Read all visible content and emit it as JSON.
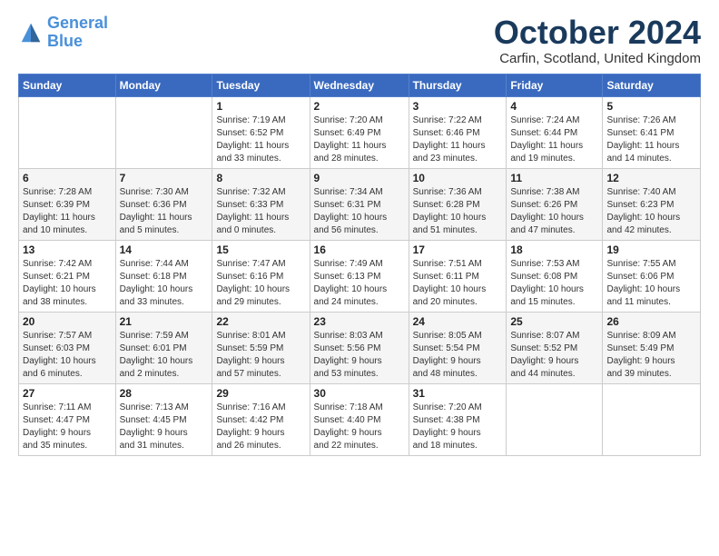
{
  "logo": {
    "line1": "General",
    "line2": "Blue"
  },
  "title": "October 2024",
  "subtitle": "Carfin, Scotland, United Kingdom",
  "days_of_week": [
    "Sunday",
    "Monday",
    "Tuesday",
    "Wednesday",
    "Thursday",
    "Friday",
    "Saturday"
  ],
  "weeks": [
    [
      {
        "day": "",
        "info": ""
      },
      {
        "day": "",
        "info": ""
      },
      {
        "day": "1",
        "info": "Sunrise: 7:19 AM\nSunset: 6:52 PM\nDaylight: 11 hours\nand 33 minutes."
      },
      {
        "day": "2",
        "info": "Sunrise: 7:20 AM\nSunset: 6:49 PM\nDaylight: 11 hours\nand 28 minutes."
      },
      {
        "day": "3",
        "info": "Sunrise: 7:22 AM\nSunset: 6:46 PM\nDaylight: 11 hours\nand 23 minutes."
      },
      {
        "day": "4",
        "info": "Sunrise: 7:24 AM\nSunset: 6:44 PM\nDaylight: 11 hours\nand 19 minutes."
      },
      {
        "day": "5",
        "info": "Sunrise: 7:26 AM\nSunset: 6:41 PM\nDaylight: 11 hours\nand 14 minutes."
      }
    ],
    [
      {
        "day": "6",
        "info": "Sunrise: 7:28 AM\nSunset: 6:39 PM\nDaylight: 11 hours\nand 10 minutes."
      },
      {
        "day": "7",
        "info": "Sunrise: 7:30 AM\nSunset: 6:36 PM\nDaylight: 11 hours\nand 5 minutes."
      },
      {
        "day": "8",
        "info": "Sunrise: 7:32 AM\nSunset: 6:33 PM\nDaylight: 11 hours\nand 0 minutes."
      },
      {
        "day": "9",
        "info": "Sunrise: 7:34 AM\nSunset: 6:31 PM\nDaylight: 10 hours\nand 56 minutes."
      },
      {
        "day": "10",
        "info": "Sunrise: 7:36 AM\nSunset: 6:28 PM\nDaylight: 10 hours\nand 51 minutes."
      },
      {
        "day": "11",
        "info": "Sunrise: 7:38 AM\nSunset: 6:26 PM\nDaylight: 10 hours\nand 47 minutes."
      },
      {
        "day": "12",
        "info": "Sunrise: 7:40 AM\nSunset: 6:23 PM\nDaylight: 10 hours\nand 42 minutes."
      }
    ],
    [
      {
        "day": "13",
        "info": "Sunrise: 7:42 AM\nSunset: 6:21 PM\nDaylight: 10 hours\nand 38 minutes."
      },
      {
        "day": "14",
        "info": "Sunrise: 7:44 AM\nSunset: 6:18 PM\nDaylight: 10 hours\nand 33 minutes."
      },
      {
        "day": "15",
        "info": "Sunrise: 7:47 AM\nSunset: 6:16 PM\nDaylight: 10 hours\nand 29 minutes."
      },
      {
        "day": "16",
        "info": "Sunrise: 7:49 AM\nSunset: 6:13 PM\nDaylight: 10 hours\nand 24 minutes."
      },
      {
        "day": "17",
        "info": "Sunrise: 7:51 AM\nSunset: 6:11 PM\nDaylight: 10 hours\nand 20 minutes."
      },
      {
        "day": "18",
        "info": "Sunrise: 7:53 AM\nSunset: 6:08 PM\nDaylight: 10 hours\nand 15 minutes."
      },
      {
        "day": "19",
        "info": "Sunrise: 7:55 AM\nSunset: 6:06 PM\nDaylight: 10 hours\nand 11 minutes."
      }
    ],
    [
      {
        "day": "20",
        "info": "Sunrise: 7:57 AM\nSunset: 6:03 PM\nDaylight: 10 hours\nand 6 minutes."
      },
      {
        "day": "21",
        "info": "Sunrise: 7:59 AM\nSunset: 6:01 PM\nDaylight: 10 hours\nand 2 minutes."
      },
      {
        "day": "22",
        "info": "Sunrise: 8:01 AM\nSunset: 5:59 PM\nDaylight: 9 hours\nand 57 minutes."
      },
      {
        "day": "23",
        "info": "Sunrise: 8:03 AM\nSunset: 5:56 PM\nDaylight: 9 hours\nand 53 minutes."
      },
      {
        "day": "24",
        "info": "Sunrise: 8:05 AM\nSunset: 5:54 PM\nDaylight: 9 hours\nand 48 minutes."
      },
      {
        "day": "25",
        "info": "Sunrise: 8:07 AM\nSunset: 5:52 PM\nDaylight: 9 hours\nand 44 minutes."
      },
      {
        "day": "26",
        "info": "Sunrise: 8:09 AM\nSunset: 5:49 PM\nDaylight: 9 hours\nand 39 minutes."
      }
    ],
    [
      {
        "day": "27",
        "info": "Sunrise: 7:11 AM\nSunset: 4:47 PM\nDaylight: 9 hours\nand 35 minutes."
      },
      {
        "day": "28",
        "info": "Sunrise: 7:13 AM\nSunset: 4:45 PM\nDaylight: 9 hours\nand 31 minutes."
      },
      {
        "day": "29",
        "info": "Sunrise: 7:16 AM\nSunset: 4:42 PM\nDaylight: 9 hours\nand 26 minutes."
      },
      {
        "day": "30",
        "info": "Sunrise: 7:18 AM\nSunset: 4:40 PM\nDaylight: 9 hours\nand 22 minutes."
      },
      {
        "day": "31",
        "info": "Sunrise: 7:20 AM\nSunset: 4:38 PM\nDaylight: 9 hours\nand 18 minutes."
      },
      {
        "day": "",
        "info": ""
      },
      {
        "day": "",
        "info": ""
      }
    ]
  ]
}
